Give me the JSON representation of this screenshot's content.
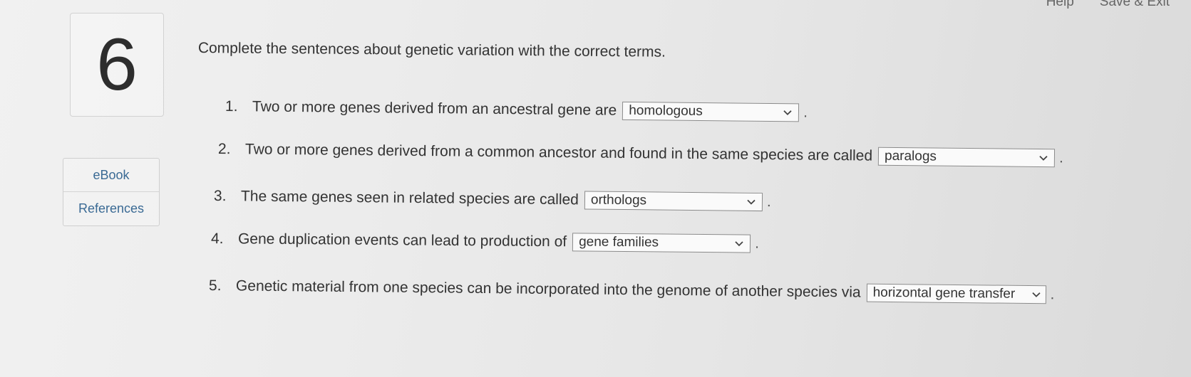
{
  "topbar": {
    "help_label": "Help",
    "save_exit_label": "Save & Exit"
  },
  "question": {
    "number": "6",
    "prompt": "Complete the sentences about genetic variation with the correct terms."
  },
  "side": {
    "ebook_label": "eBook",
    "references_label": "References"
  },
  "items": [
    {
      "num": "1.",
      "text": "Two or more genes derived from an ancestral gene are",
      "selected": "homologous",
      "end": "."
    },
    {
      "num": "2.",
      "text": "Two or more genes derived from a common ancestor and found in the same species are called",
      "selected": "paralogs",
      "end": "."
    },
    {
      "num": "3.",
      "text": "The same genes seen in related species are called",
      "selected": "orthologs",
      "end": "."
    },
    {
      "num": "4.",
      "text": "Gene duplication events can lead to production of",
      "selected": "gene families",
      "end": "."
    },
    {
      "num": "5.",
      "text": "Genetic material from one species can be incorporated into the genome of another species via",
      "selected": "horizontal gene transfer",
      "end": "."
    }
  ]
}
